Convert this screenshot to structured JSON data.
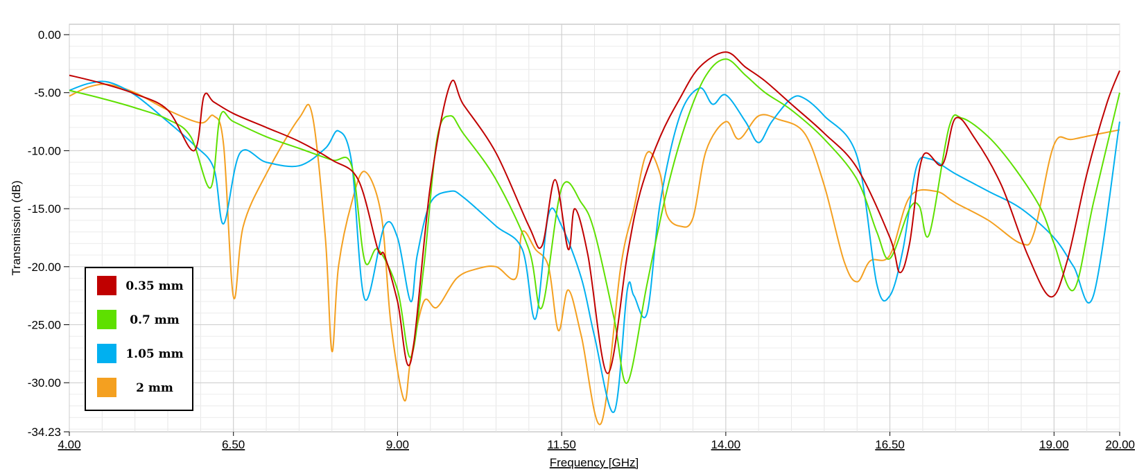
{
  "chart_data": {
    "type": "line",
    "xlabel": "Frequency [GHz]",
    "ylabel": "Transmission (dB)",
    "xlim": [
      4.0,
      20.0
    ],
    "ylim": [
      -34.23,
      0.0
    ],
    "xticks": [
      "4.00",
      "6.50",
      "9.00",
      "11.50",
      "14.00",
      "16.50",
      "19.00",
      "20.00"
    ],
    "yticks": [
      "0.00",
      "-5.00",
      "-10.00",
      "-15.00",
      "-20.00",
      "-25.00",
      "-30.00",
      "-34.23"
    ],
    "grid": true,
    "legend_position": "bottom-left",
    "series": [
      {
        "name": "0.35 mm",
        "color": "#c00000",
        "x": [
          4.0,
          4.5,
          5.0,
          5.5,
          5.9,
          6.05,
          6.2,
          6.5,
          7.0,
          7.5,
          8.0,
          8.4,
          8.7,
          8.8,
          9.0,
          9.2,
          9.5,
          9.8,
          10.0,
          10.5,
          11.0,
          11.2,
          11.4,
          11.6,
          11.7,
          11.9,
          12.2,
          12.5,
          12.7,
          13.0,
          13.3,
          13.6,
          14.0,
          14.3,
          14.6,
          15.0,
          15.5,
          16.0,
          16.5,
          16.65,
          16.8,
          17.0,
          17.3,
          17.5,
          17.8,
          18.2,
          18.6,
          18.95,
          19.2,
          19.5,
          19.8,
          20.0
        ],
        "values": [
          -3.5,
          -4.2,
          -5.1,
          -6.5,
          -10.0,
          -5.3,
          -5.8,
          -6.8,
          -8.0,
          -9.2,
          -10.8,
          -12.5,
          -18.5,
          -19.0,
          -23.0,
          -28.2,
          -13.0,
          -4.3,
          -6.0,
          -10.2,
          -16.5,
          -18.2,
          -12.5,
          -18.5,
          -15.0,
          -19.0,
          -29.2,
          -19.0,
          -13.5,
          -8.8,
          -5.5,
          -2.8,
          -1.5,
          -2.8,
          -4.0,
          -6.0,
          -8.5,
          -11.5,
          -17.5,
          -20.5,
          -18.0,
          -10.5,
          -11.2,
          -7.2,
          -9.0,
          -13.0,
          -19.0,
          -22.6,
          -19.5,
          -12.0,
          -6.0,
          -3.1
        ]
      },
      {
        "name": "0.7 mm",
        "color": "#5ee000",
        "x": [
          4.0,
          4.5,
          5.0,
          5.5,
          5.85,
          6.15,
          6.3,
          6.5,
          7.0,
          7.5,
          8.0,
          8.3,
          8.5,
          8.7,
          9.0,
          9.2,
          9.4,
          9.6,
          9.8,
          10.0,
          10.5,
          11.0,
          11.2,
          11.5,
          11.8,
          12.0,
          12.3,
          12.5,
          12.8,
          13.1,
          13.4,
          13.7,
          14.0,
          14.3,
          14.6,
          15.0,
          15.5,
          16.0,
          16.3,
          16.5,
          16.8,
          16.95,
          17.1,
          17.4,
          17.6,
          18.0,
          18.4,
          18.8,
          19.0,
          19.3,
          19.6,
          20.0
        ],
        "values": [
          -4.8,
          -5.5,
          -6.3,
          -7.3,
          -8.8,
          -13.2,
          -7.0,
          -7.5,
          -8.8,
          -9.8,
          -10.8,
          -11.3,
          -19.5,
          -18.5,
          -22.0,
          -27.8,
          -20.0,
          -9.0,
          -7.0,
          -8.5,
          -12.5,
          -18.5,
          -23.5,
          -13.2,
          -14.5,
          -17.0,
          -24.5,
          -30.0,
          -21.5,
          -13.5,
          -7.5,
          -3.5,
          -2.1,
          -3.5,
          -5.0,
          -6.5,
          -9.0,
          -12.5,
          -17.0,
          -19.3,
          -15.0,
          -14.8,
          -17.2,
          -8.0,
          -7.2,
          -8.8,
          -11.5,
          -15.0,
          -18.0,
          -22.0,
          -14.5,
          -5.0
        ]
      },
      {
        "name": "1.05 mm",
        "color": "#00b0f0",
        "x": [
          4.0,
          4.3,
          4.6,
          5.0,
          5.5,
          5.9,
          6.2,
          6.35,
          6.6,
          7.0,
          7.5,
          7.9,
          8.1,
          8.3,
          8.5,
          8.8,
          9.0,
          9.2,
          9.3,
          9.5,
          9.8,
          10.0,
          10.5,
          10.9,
          11.1,
          11.3,
          11.5,
          11.8,
          12.0,
          12.3,
          12.5,
          12.6,
          12.8,
          13.0,
          13.3,
          13.6,
          13.8,
          14.0,
          14.3,
          14.5,
          14.7,
          15.0,
          15.2,
          15.5,
          16.0,
          16.3,
          16.5,
          16.7,
          16.9,
          17.1,
          17.5,
          18.0,
          18.5,
          19.0,
          19.3,
          19.6,
          20.0
        ],
        "values": [
          -4.8,
          -4.2,
          -4.1,
          -5.2,
          -7.5,
          -9.5,
          -11.5,
          -16.3,
          -10.2,
          -11.0,
          -11.3,
          -9.8,
          -8.3,
          -11.0,
          -22.8,
          -16.5,
          -17.5,
          -23.0,
          -19.0,
          -14.5,
          -13.5,
          -14.0,
          -16.5,
          -18.5,
          -24.5,
          -15.5,
          -16.5,
          -21.0,
          -26.0,
          -32.5,
          -22.0,
          -22.5,
          -24.0,
          -14.5,
          -7.0,
          -4.6,
          -6.0,
          -5.2,
          -7.5,
          -9.3,
          -7.5,
          -5.5,
          -5.5,
          -7.0,
          -10.5,
          -21.5,
          -22.5,
          -18.5,
          -11.5,
          -10.7,
          -12.0,
          -13.5,
          -15.0,
          -17.5,
          -20.0,
          -22.5,
          -7.5
        ]
      },
      {
        "name": "2 mm",
        "color": "#f4a020",
        "x": [
          4.0,
          4.3,
          4.6,
          5.0,
          5.5,
          6.0,
          6.2,
          6.35,
          6.5,
          6.65,
          7.0,
          7.5,
          7.7,
          7.9,
          8.0,
          8.1,
          8.3,
          8.5,
          8.75,
          8.9,
          9.1,
          9.2,
          9.4,
          9.6,
          9.9,
          10.2,
          10.5,
          10.8,
          10.9,
          11.1,
          11.3,
          11.45,
          11.6,
          11.8,
          12.1,
          12.4,
          12.6,
          12.8,
          13.0,
          13.1,
          13.3,
          13.5,
          13.7,
          14.0,
          14.2,
          14.5,
          14.8,
          15.2,
          15.5,
          15.8,
          16.0,
          16.2,
          16.5,
          16.8,
          17.2,
          17.5,
          18.0,
          18.5,
          18.7,
          19.0,
          19.3,
          20.0
        ],
        "values": [
          -5.3,
          -4.5,
          -4.3,
          -5.0,
          -6.5,
          -7.6,
          -7.0,
          -9.5,
          -22.6,
          -16.5,
          -12.0,
          -7.2,
          -6.9,
          -17.5,
          -27.3,
          -20.0,
          -14.5,
          -11.8,
          -15.5,
          -25.0,
          -31.5,
          -28.0,
          -23.0,
          -23.5,
          -21.0,
          -20.2,
          -20.0,
          -21.0,
          -17.0,
          -18.5,
          -20.0,
          -25.5,
          -22.0,
          -26.0,
          -33.5,
          -20.0,
          -15.0,
          -10.2,
          -12.0,
          -15.5,
          -16.5,
          -15.8,
          -10.0,
          -7.5,
          -9.0,
          -7.0,
          -7.3,
          -8.5,
          -13.0,
          -19.5,
          -21.3,
          -19.5,
          -19.0,
          -14.0,
          -13.5,
          -14.5,
          -16.0,
          -18.0,
          -17.0,
          -9.5,
          -9.0,
          -8.2
        ]
      }
    ]
  }
}
